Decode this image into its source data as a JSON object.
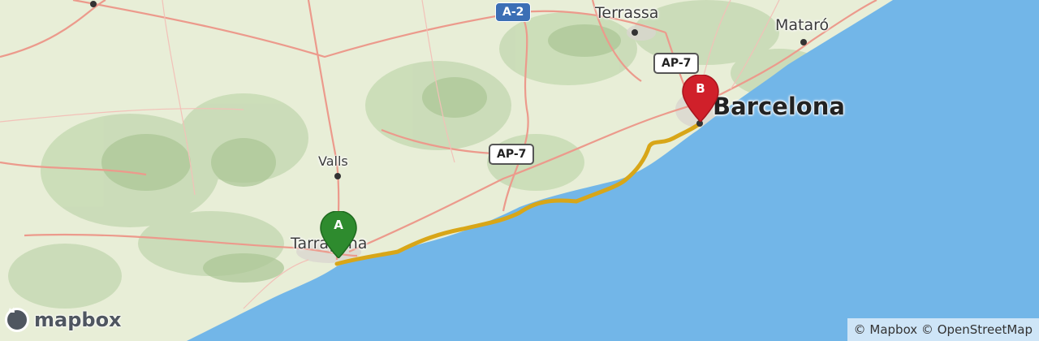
{
  "places": {
    "barcelona": "Barcelona",
    "tarragona": "Tarragona",
    "terrassa": "Terrassa",
    "mataro": "Mataró",
    "valls": "Valls"
  },
  "roads": {
    "a2": "A-2",
    "ap7_north": "AP-7",
    "ap7_middle": "AP-7"
  },
  "markers": {
    "start": {
      "label": "A",
      "color": "#2e8b2e"
    },
    "end": {
      "label": "B",
      "color": "#d0202a"
    }
  },
  "route": {
    "color": "#d8a618"
  },
  "colors": {
    "sea": "#72b6e8",
    "land": "#e8eed7",
    "relief": "#b7cfa3"
  },
  "logo": {
    "text": "mapbox"
  },
  "attribution": {
    "text": "© Mapbox © OpenStreetMap"
  }
}
